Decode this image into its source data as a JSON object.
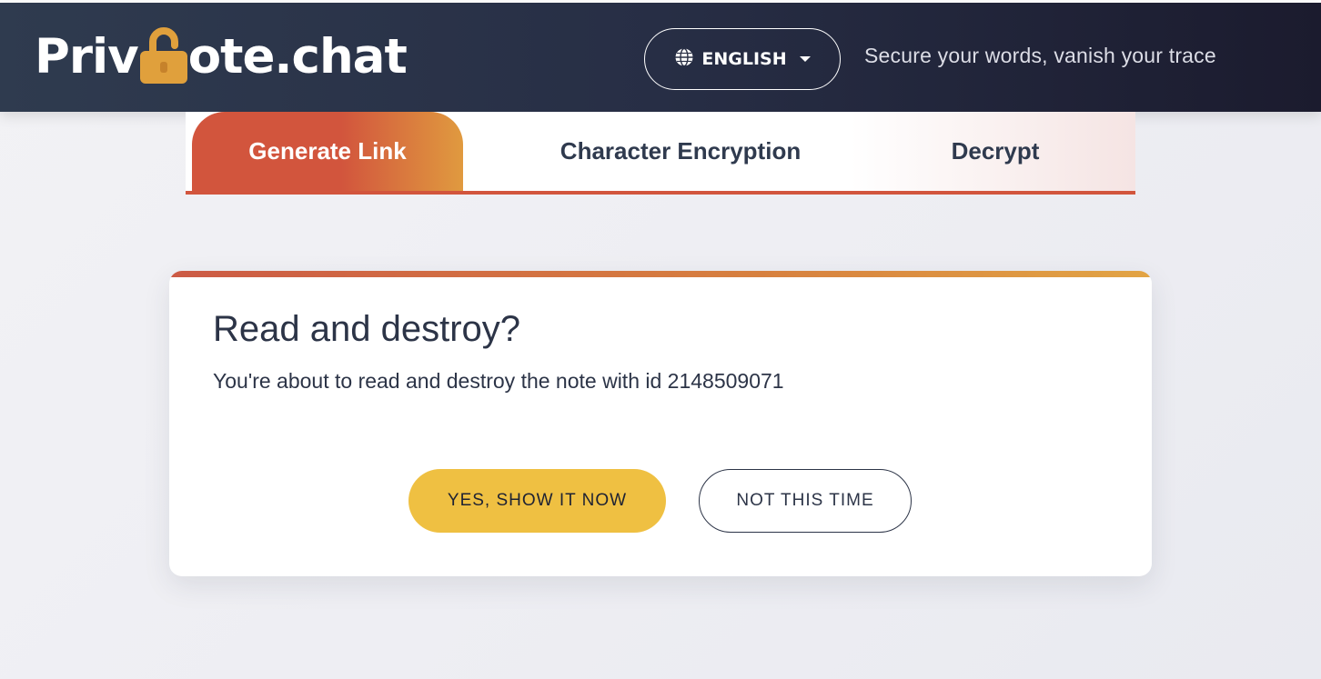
{
  "header": {
    "logo_prefix": "Priv",
    "logo_suffix": "ote.chat",
    "logo_icon": "padlock-open-icon",
    "language_label": "ENGLISH",
    "language_icon": "globe-icon",
    "tagline": "Secure your words, vanish your trace"
  },
  "tabs": [
    {
      "label": "Generate Link",
      "active": true
    },
    {
      "label": "Character Encryption",
      "active": false
    },
    {
      "label": "Decrypt",
      "active": false
    }
  ],
  "dialog": {
    "title": "Read and destroy?",
    "message": "You're about to read and destroy the note with id 2148509071",
    "confirm_label": "YES, SHOW IT NOW",
    "cancel_label": "NOT THIS TIME"
  },
  "colors": {
    "header_dark": "#1b1b2e",
    "accent_red": "#d2553d",
    "accent_orange": "#e09a3f",
    "confirm_yellow": "#efc042",
    "text_dark": "#2c3447"
  }
}
